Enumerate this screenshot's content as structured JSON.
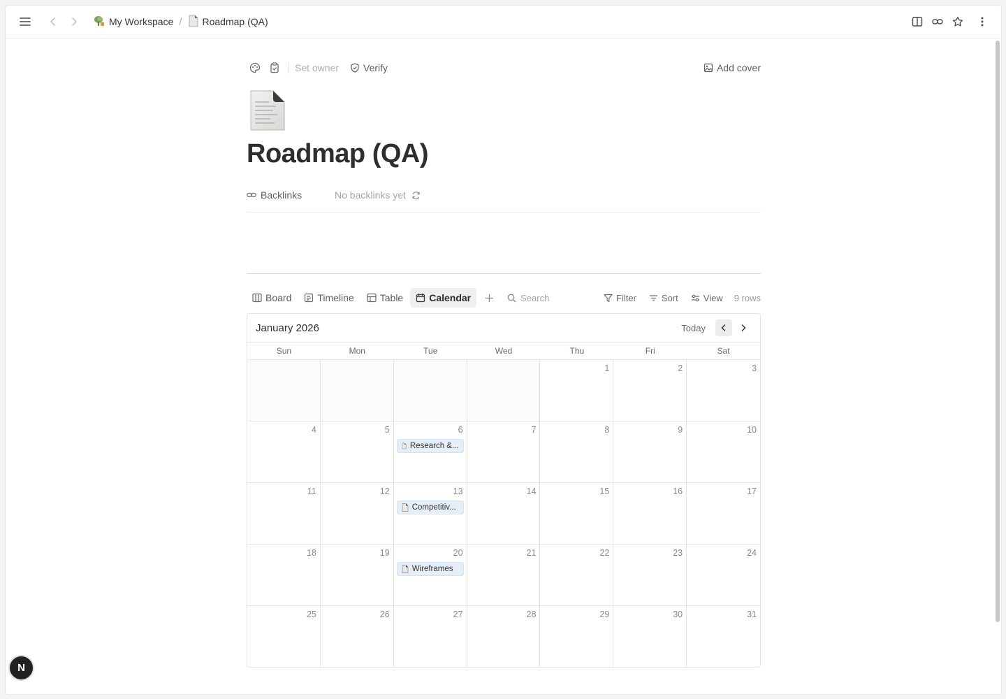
{
  "topbar": {
    "workspace_name": "My Workspace",
    "page_name": "Roadmap (QA)",
    "separator": "/"
  },
  "meta": {
    "set_owner": "Set owner",
    "verify": "Verify",
    "add_cover": "Add cover"
  },
  "page": {
    "title": "Roadmap (QA)",
    "backlinks_label": "Backlinks",
    "backlinks_empty": "No backlinks yet"
  },
  "views": {
    "tabs": [
      {
        "label": "Board",
        "icon": "board-icon"
      },
      {
        "label": "Timeline",
        "icon": "timeline-icon"
      },
      {
        "label": "Table",
        "icon": "table-icon"
      },
      {
        "label": "Calendar",
        "icon": "calendar-icon",
        "active": true
      }
    ],
    "search_placeholder": "Search",
    "filter": "Filter",
    "sort": "Sort",
    "view": "View",
    "row_count": "9 rows"
  },
  "calendar": {
    "month": "January 2026",
    "today": "Today",
    "weekdays": [
      "Sun",
      "Mon",
      "Tue",
      "Wed",
      "Thu",
      "Fri",
      "Sat"
    ],
    "leading_blanks": 4,
    "days_in_month": 31,
    "events": [
      {
        "day": 6,
        "title": "Research &..."
      },
      {
        "day": 13,
        "title": "Competitiv..."
      },
      {
        "day": 20,
        "title": "Wireframes"
      }
    ]
  },
  "user": {
    "avatar_initial": "N"
  },
  "colors": {
    "active_tab_bg": "#efefee",
    "event_bg": "#e6eef7",
    "avatar_bg": "#222222"
  }
}
